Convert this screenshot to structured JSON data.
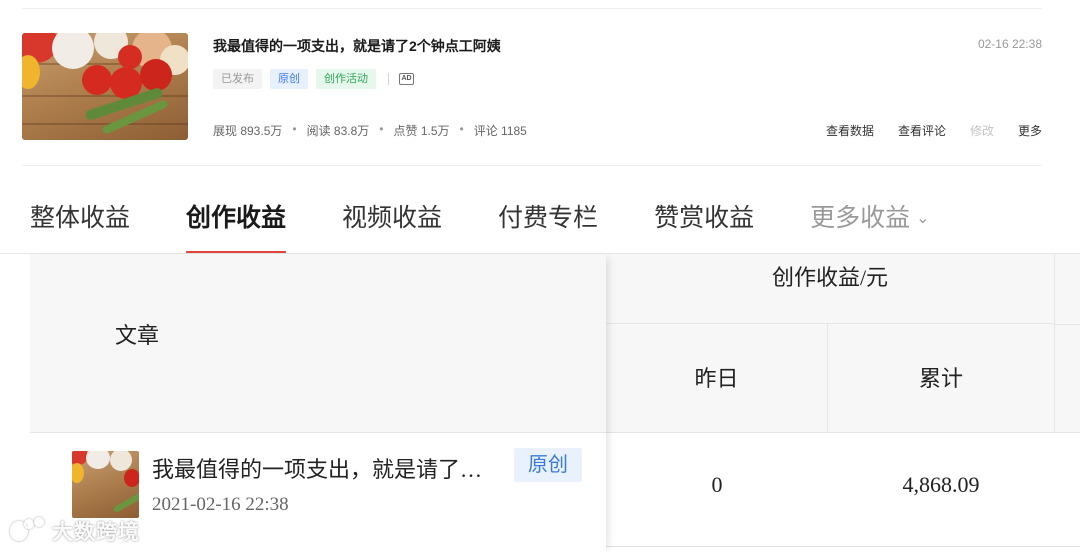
{
  "card": {
    "title": "我最值得的一项支出，就是请了2个钟点工阿姨",
    "time": "02-16 22:38",
    "tags": {
      "published": "已发布",
      "original": "原创",
      "activity": "创作活动",
      "ad_icon": "AD"
    },
    "stats": {
      "impressions": "展现 893.5万",
      "reads": "阅读 83.8万",
      "likes": "点赞 1.5万",
      "comments": "评论 1185",
      "separator": "•"
    },
    "actions": {
      "view_data": "查看数据",
      "view_comments": "查看评论",
      "edit": "修改",
      "more": "更多"
    }
  },
  "tabs": [
    {
      "label": "整体收益"
    },
    {
      "label": "创作收益"
    },
    {
      "label": "视频收益"
    },
    {
      "label": "付费专栏"
    },
    {
      "label": "赞赏收益"
    },
    {
      "label": "更多收益"
    }
  ],
  "active_tab_index": 1,
  "table": {
    "article_header": "文章",
    "group_header": "创作收益/元",
    "col_yesterday": "昨日",
    "col_total": "累计",
    "rows": [
      {
        "title": "我最值得的一项支出，就是请了…",
        "badge": "原创",
        "date": "2021-02-16 22:38",
        "yesterday": "0",
        "total": "4,868.09"
      }
    ]
  },
  "watermark": {
    "text": "大数跨境"
  },
  "colors": {
    "accent_red": "#e0453a",
    "original_blue": "#3d7cf2",
    "activity_green": "#2fa85a"
  },
  "icons": {
    "ad": "ad-icon",
    "chevron": "chevron-down-icon",
    "thumbnail": "vegetables-thumbnail"
  }
}
